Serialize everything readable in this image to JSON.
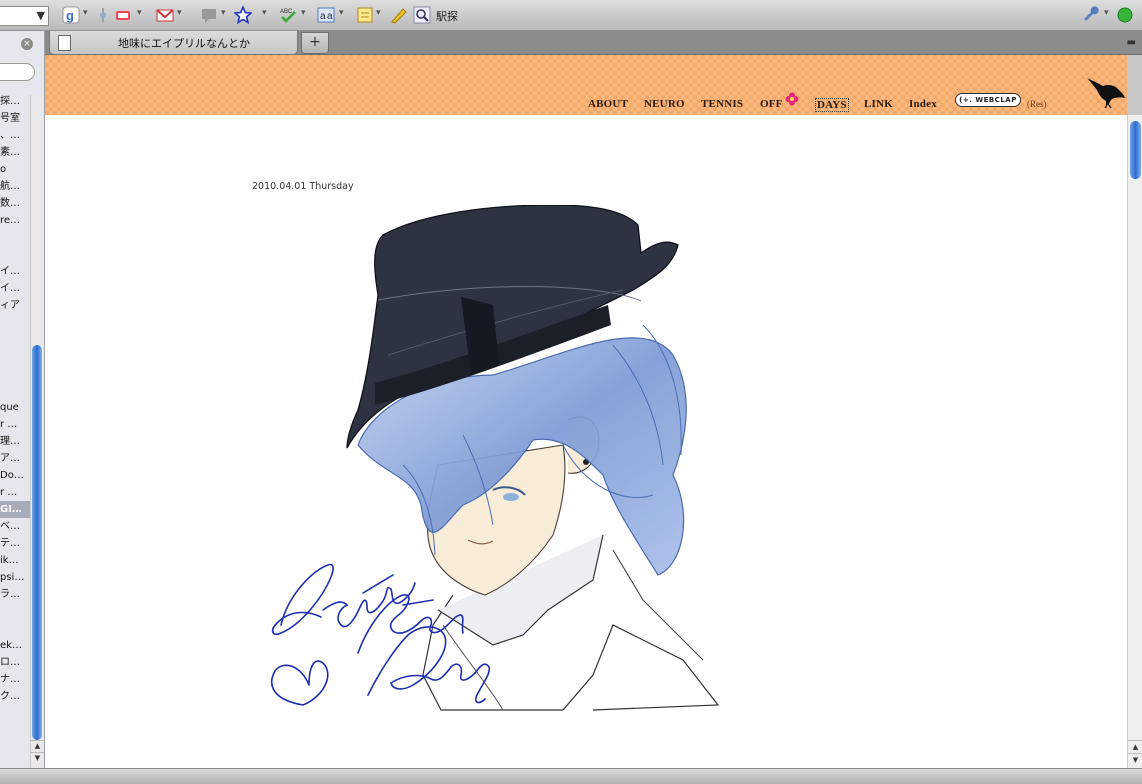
{
  "toolbar": {
    "search_text": "駅探"
  },
  "sidebar": {
    "close_glyph": "×",
    "items": [
      {
        "label": "探…",
        "selected": false
      },
      {
        "label": "号室",
        "selected": false
      },
      {
        "label": "、…",
        "selected": false
      },
      {
        "label": "素…",
        "selected": false
      },
      {
        "label": "o",
        "selected": false
      },
      {
        "label": "航…",
        "selected": false
      },
      {
        "label": "数…",
        "selected": false
      },
      {
        "label": "re…",
        "selected": false
      },
      {
        "label": "イ…",
        "selected": false
      },
      {
        "label": "イ…",
        "selected": false
      },
      {
        "label": "ィア",
        "selected": false
      },
      {
        "label": "que",
        "selected": false
      },
      {
        "label": "r …",
        "selected": false
      },
      {
        "label": "理…",
        "selected": false
      },
      {
        "label": "ア…",
        "selected": false
      },
      {
        "label": "Do…",
        "selected": false
      },
      {
        "label": "r …",
        "selected": false
      },
      {
        "label": "GI…",
        "selected": true
      },
      {
        "label": "ベ…",
        "selected": false
      },
      {
        "label": "テ…",
        "selected": false
      },
      {
        "label": "ik…",
        "selected": false
      },
      {
        "label": "psi…",
        "selected": false
      },
      {
        "label": "ラ…",
        "selected": false
      },
      {
        "label": "ek…",
        "selected": false
      },
      {
        "label": "ロ…",
        "selected": false
      },
      {
        "label": "ナ…",
        "selected": false
      },
      {
        "label": "ク…",
        "selected": false
      }
    ]
  },
  "tabs": {
    "active_title": "地味にエイプリルなんとか",
    "new_tab_glyph": "+"
  },
  "site": {
    "nav": [
      "ABOUT",
      "NEURO",
      "TENNIS",
      "OFF",
      "DAYS",
      "LINK",
      "Index"
    ],
    "webclap_label": "WEBCLAP",
    "res_label": "(Res)"
  },
  "post": {
    "date": "2010.04.01 Thursday",
    "illustration_text": "April Fool's Day"
  },
  "colors": {
    "header_orange": "#f6a866",
    "scroll_blue": "#2d6cd0",
    "signature_blue": "#1c2fb0"
  }
}
